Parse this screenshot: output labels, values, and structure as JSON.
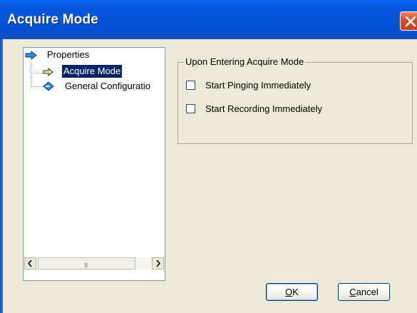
{
  "window": {
    "title": "Acquire Mode"
  },
  "tree": {
    "items": [
      {
        "label": "Properties",
        "icon": "arrow-right-icon"
      },
      {
        "label": "Acquire Mode",
        "icon": "arrow-right-icon",
        "selected": true
      },
      {
        "label": "General Configuratio",
        "icon": "diamond-arrow-icon"
      }
    ],
    "scroll_grip": "III"
  },
  "group": {
    "title": "Upon Entering Acquire Mode",
    "options": [
      {
        "label": "Start Pinging Immediately",
        "checked": false
      },
      {
        "label": "Start Recording Immediately",
        "checked": false
      }
    ]
  },
  "buttons": {
    "ok_mnemonic": "O",
    "ok_rest": "K",
    "cancel_mnemonic": "C",
    "cancel_rest": "ancel"
  },
  "colors": {
    "title_bar": "#0553d8",
    "selection": "#0a246a",
    "dialog_bg": "#ece9d8",
    "close_button": "#d4502a"
  }
}
